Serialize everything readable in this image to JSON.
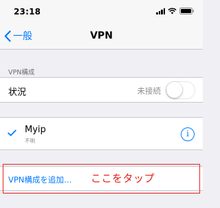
{
  "status_bar": {
    "time": "23:18"
  },
  "nav": {
    "back_label": "一般",
    "title": "VPN"
  },
  "vpn_config": {
    "section_header": "VPN構成",
    "status_label": "状況",
    "status_value": "未接続",
    "toggle_on": false
  },
  "vpn_list": [
    {
      "name": "Myip",
      "subtitle": "不明",
      "selected": true
    }
  ],
  "add_config_label": "VPN構成を追加…",
  "annotation": {
    "text": "ここをタップ",
    "color": "#e8211d"
  },
  "colors": {
    "accent": "#007aff",
    "background": "#efeff4"
  },
  "icons": [
    "signal-icon",
    "wifi-icon",
    "battery-icon",
    "chevron-left-icon",
    "checkmark-icon",
    "info-icon"
  ]
}
